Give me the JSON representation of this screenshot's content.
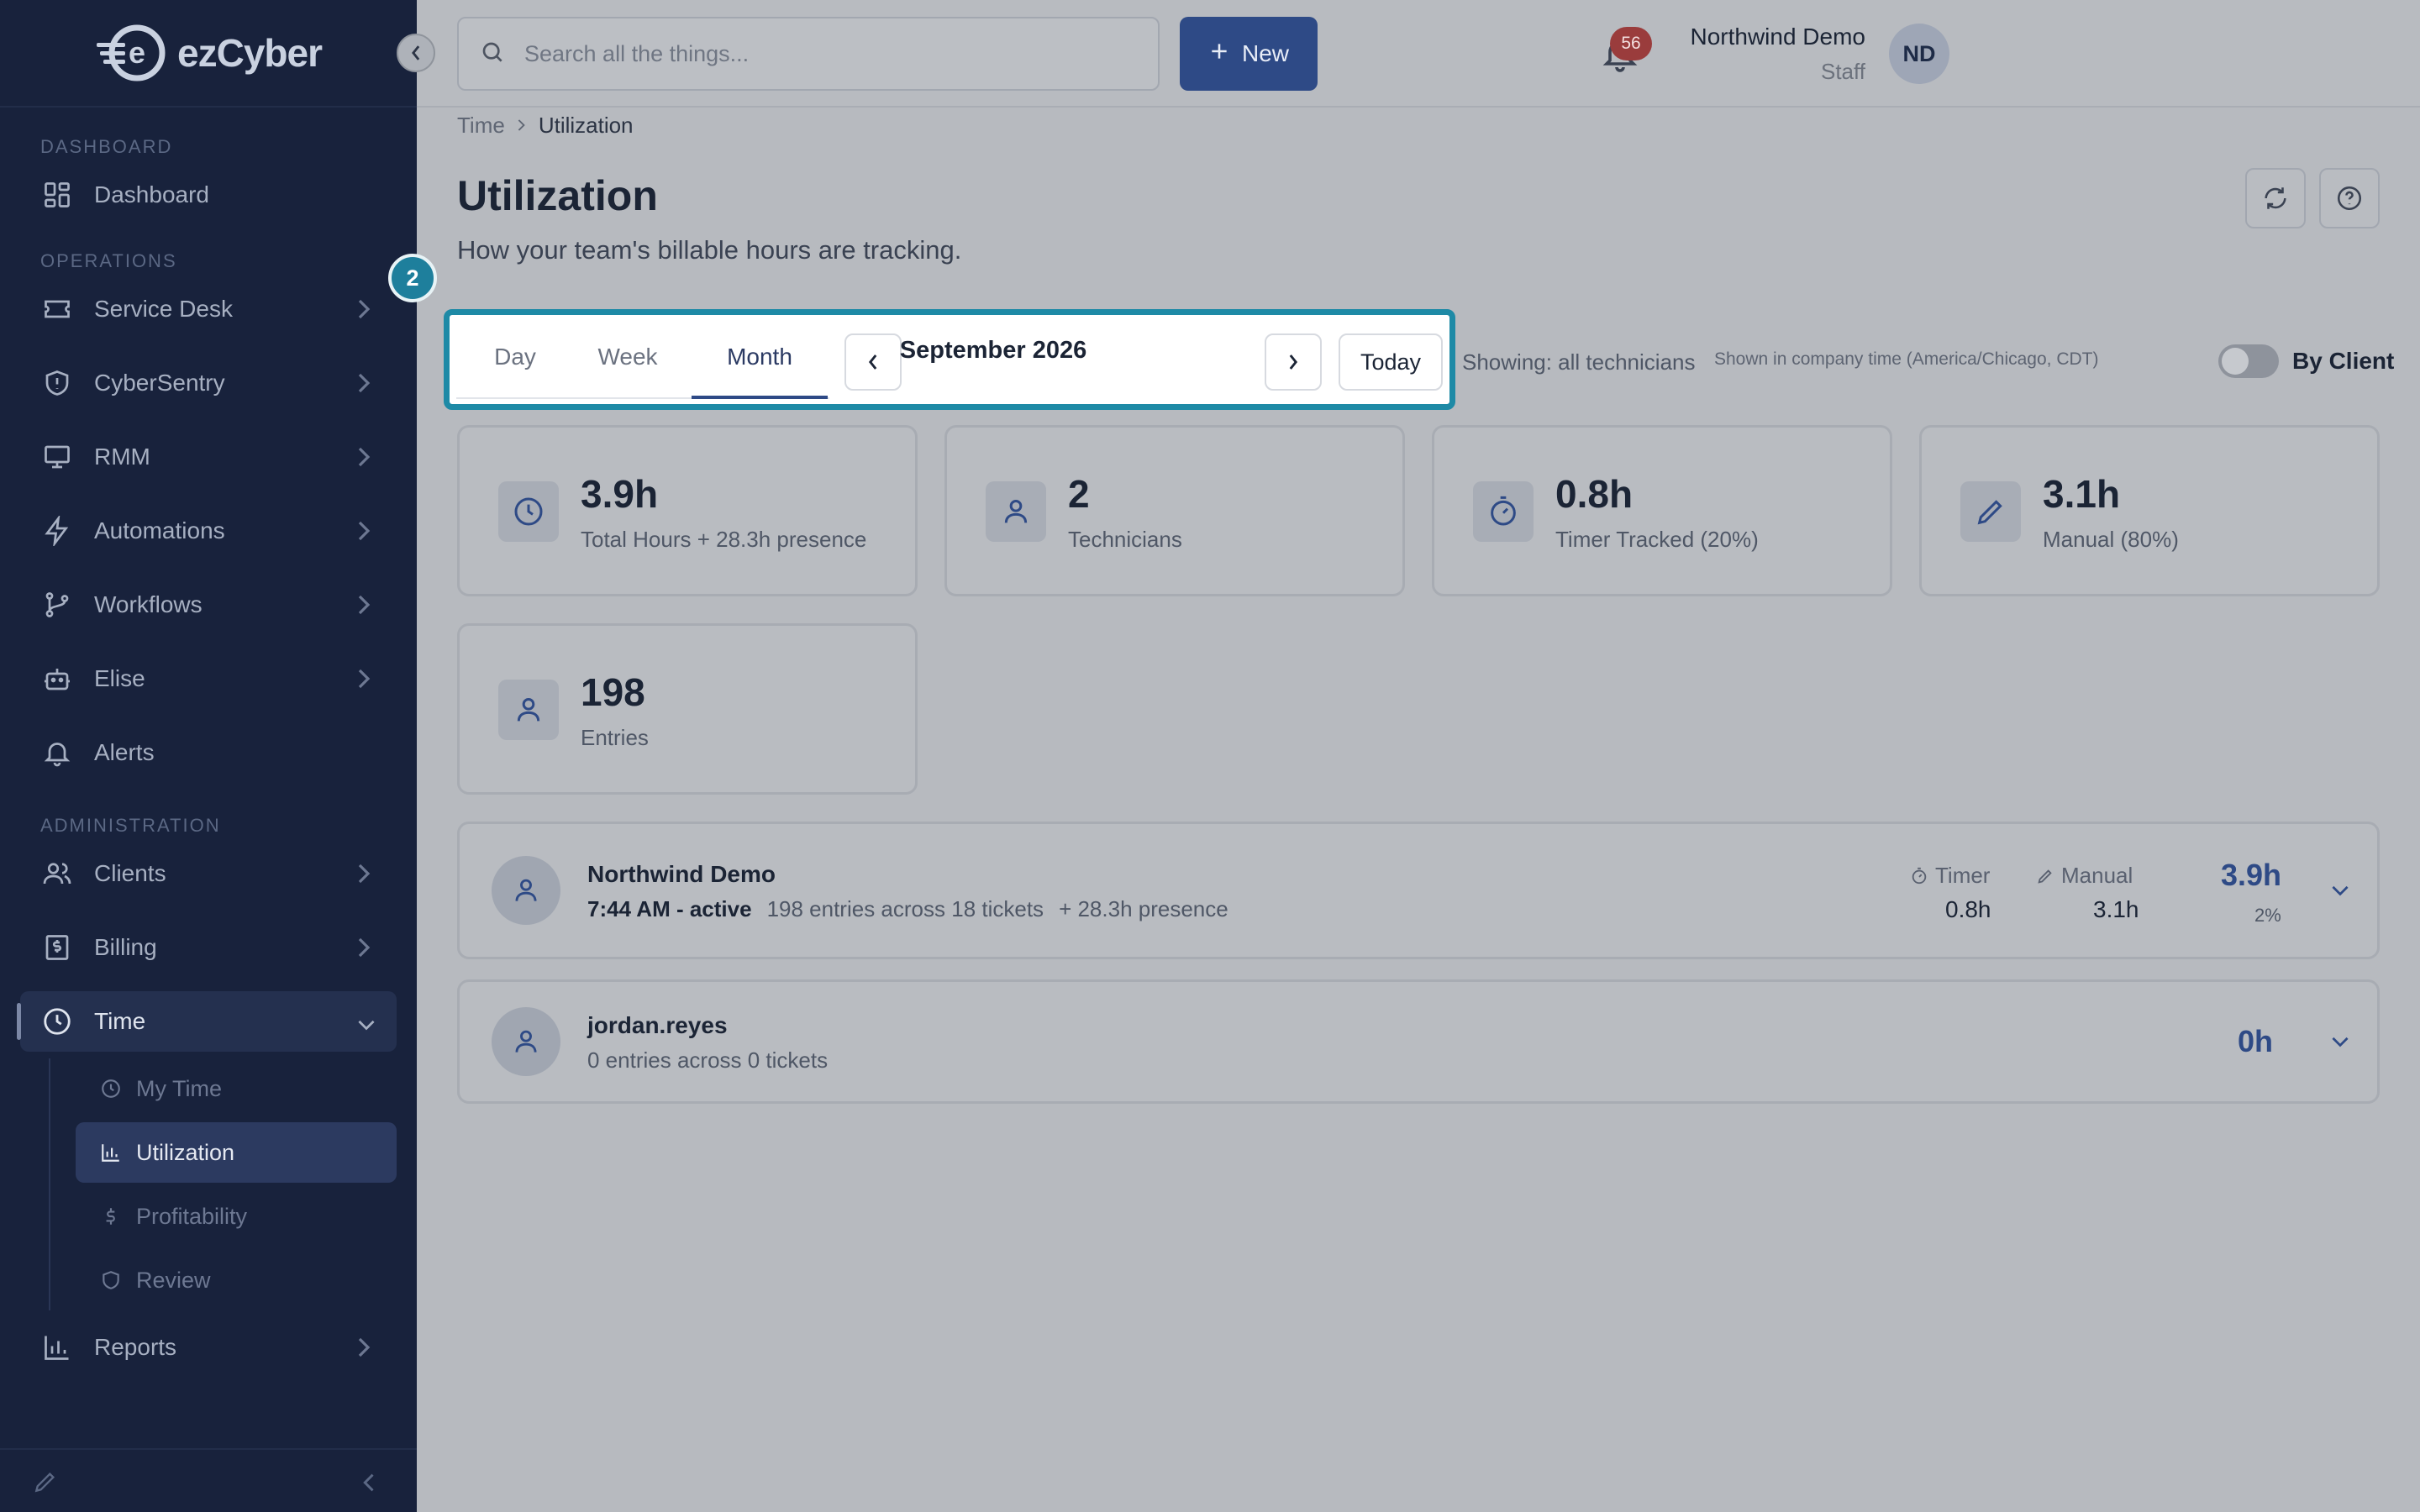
{
  "brand": {
    "name": "ezCyber",
    "logo_letter": "e"
  },
  "sidebar": {
    "sections": {
      "dashboard": "DASHBOARD",
      "operations": "OPERATIONS",
      "administration": "ADMINISTRATION"
    },
    "items": {
      "dashboard": "Dashboard",
      "service_desk": "Service Desk",
      "cybersentry": "CyberSentry",
      "rmm": "RMM",
      "automations": "Automations",
      "workflows": "Workflows",
      "elise": "Elise",
      "alerts": "Alerts",
      "clients": "Clients",
      "billing": "Billing",
      "time": "Time",
      "reports": "Reports"
    },
    "time_sub": {
      "my_time": "My Time",
      "utilization": "Utilization",
      "profitability": "Profitability",
      "review": "Review"
    }
  },
  "topbar": {
    "search_placeholder": "Search all the things...",
    "new_label": "New",
    "notification_count": "56",
    "user_name": "Northwind Demo",
    "user_role": "Staff",
    "avatar_initials": "ND"
  },
  "breadcrumb": {
    "parent": "Time",
    "current": "Utilization"
  },
  "page": {
    "title": "Utilization",
    "subtitle": "How your team's billable hours are tracking."
  },
  "step_badge": "2",
  "period": {
    "tabs": [
      "Day",
      "Week",
      "Month"
    ],
    "active_tab": "Month",
    "label": "September 2026",
    "today": "Today"
  },
  "filters": {
    "showing": "Showing: all technicians",
    "timezone_note": "Shown in company time (America/Chicago, CDT)",
    "by_client_label": "By Client",
    "by_client_on": false
  },
  "stats": [
    {
      "icon": "clock-icon",
      "value": "3.9h",
      "label": "Total Hours + 28.3h presence"
    },
    {
      "icon": "user-icon",
      "value": "2",
      "label": "Technicians"
    },
    {
      "icon": "stopwatch-icon",
      "value": "0.8h",
      "label": "Timer Tracked (20%)"
    },
    {
      "icon": "pencil-icon",
      "value": "3.1h",
      "label": "Manual (80%)"
    },
    {
      "icon": "user-icon",
      "value": "198",
      "label": "Entries"
    }
  ],
  "technicians": [
    {
      "name": "Northwind Demo",
      "status": "7:44 AM - active",
      "entries": "198 entries across 18 tickets",
      "presence": "+ 28.3h presence",
      "timer_label": "Timer",
      "timer_value": "0.8h",
      "manual_label": "Manual",
      "manual_value": "3.1h",
      "total": "3.9h",
      "percent": "2%"
    },
    {
      "name": "jordan.reyes",
      "entries": "0 entries across 0 tickets",
      "total": "0h"
    }
  ],
  "colors": {
    "sidebar_bg": "#18223c",
    "primary": "#2e4a86",
    "highlight": "#1e8aa6",
    "badge": "#9a3c3c"
  }
}
